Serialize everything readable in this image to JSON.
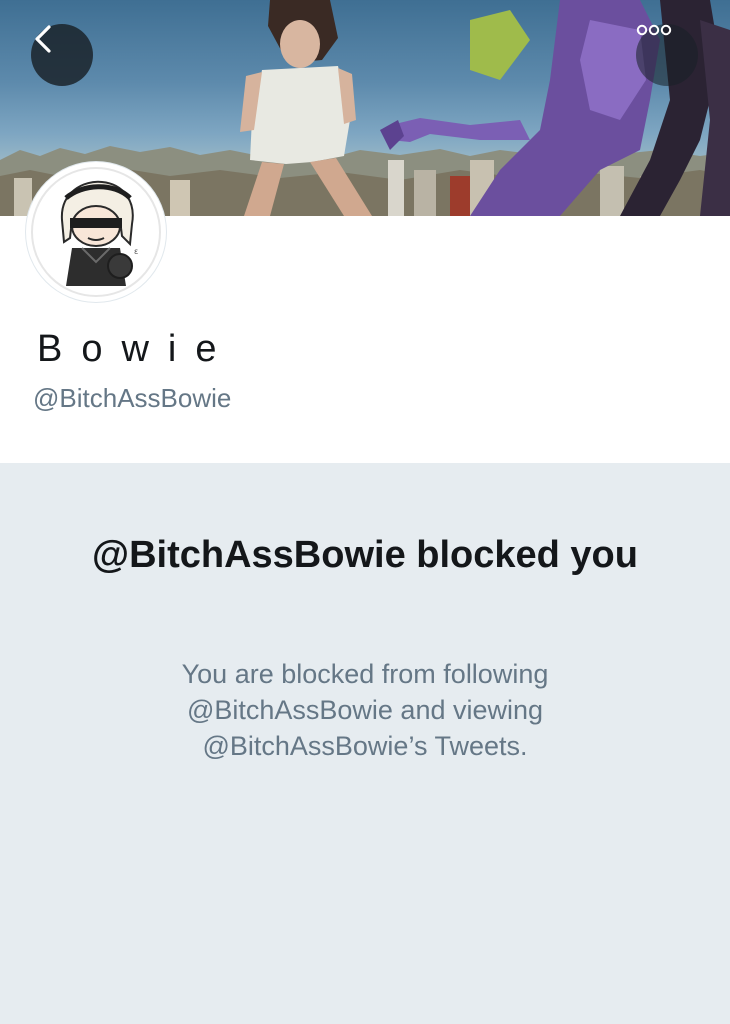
{
  "profile": {
    "display_name": "Bowie",
    "handle": "@BitchAssBowie"
  },
  "header": {
    "back_icon": "chevron-left-icon",
    "more_icon": "more-dots-icon"
  },
  "blocked": {
    "title": "@BitchAssBowie blocked you",
    "message": "You are blocked from following @BitchAssBowie and viewing @BitchAssBowie’s Tweets."
  },
  "colors": {
    "page_background": "#e6ecf0",
    "profile_background": "#ffffff",
    "primary_text": "#14171a",
    "secondary_text": "#657786"
  }
}
